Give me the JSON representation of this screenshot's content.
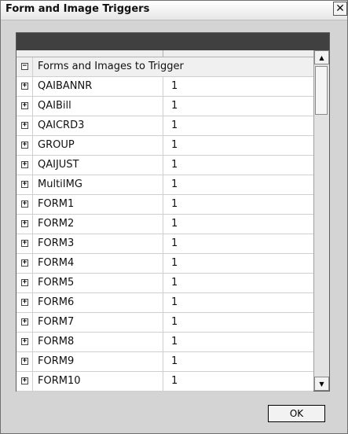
{
  "window": {
    "title": "Form and Image Triggers"
  },
  "titlebar": {
    "close_glyph": "✕"
  },
  "grid": {
    "group_label": "Forms and Images to Trigger",
    "expand_glyph": "+",
    "collapse_glyph": "−",
    "rows": [
      {
        "name": "QAIBANNR",
        "value": "1"
      },
      {
        "name": "QAIBill",
        "value": "1"
      },
      {
        "name": "QAICRD3",
        "value": "1"
      },
      {
        "name": "GROUP",
        "value": "1"
      },
      {
        "name": "QAIJUST",
        "value": "1"
      },
      {
        "name": "MultiIMG",
        "value": "1"
      },
      {
        "name": "FORM1",
        "value": "1"
      },
      {
        "name": "FORM2",
        "value": "1"
      },
      {
        "name": "FORM3",
        "value": "1"
      },
      {
        "name": "FORM4",
        "value": "1"
      },
      {
        "name": "FORM5",
        "value": "1"
      },
      {
        "name": "FORM6",
        "value": "1"
      },
      {
        "name": "FORM7",
        "value": "1"
      },
      {
        "name": "FORM8",
        "value": "1"
      },
      {
        "name": "FORM9",
        "value": "1"
      },
      {
        "name": "FORM10",
        "value": "1"
      }
    ]
  },
  "scrollbar": {
    "up_glyph": "▲",
    "down_glyph": "▼"
  },
  "buttons": {
    "ok_label": "OK"
  }
}
